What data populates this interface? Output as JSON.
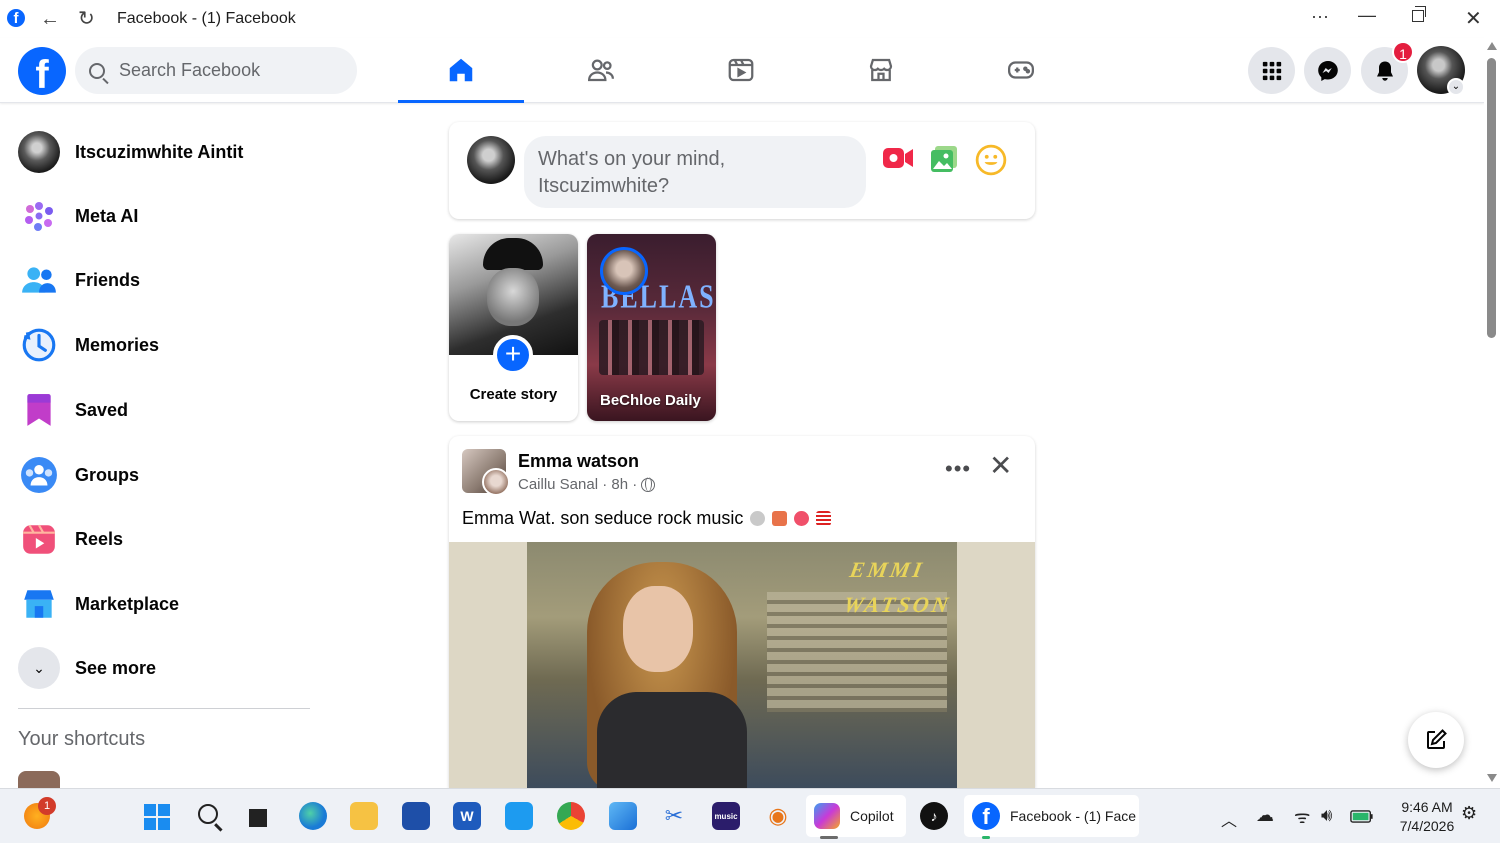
{
  "window": {
    "title": "Facebook - (1) Facebook",
    "more": "···",
    "minimize": "—",
    "close": "✕"
  },
  "header": {
    "logo": "f",
    "search_placeholder": "Search Facebook",
    "notifications_count": "1"
  },
  "sidebar": {
    "items": [
      {
        "label": "Itscuzimwhite Aintit",
        "icon": "avatar"
      },
      {
        "label": "Meta AI",
        "icon": "meta-ai-icon"
      },
      {
        "label": "Friends",
        "icon": "friends-icon"
      },
      {
        "label": "Memories",
        "icon": "memories-icon"
      },
      {
        "label": "Saved",
        "icon": "saved-icon"
      },
      {
        "label": "Groups",
        "icon": "groups-icon"
      },
      {
        "label": "Reels",
        "icon": "reels-icon"
      },
      {
        "label": "Marketplace",
        "icon": "marketplace-icon"
      },
      {
        "label": "See more",
        "icon": "chevron-down-icon"
      }
    ],
    "shortcuts_heading": "Your shortcuts"
  },
  "composer": {
    "prompt": "What's on your mind, Itscuzimwhite?"
  },
  "stories": [
    {
      "label": "Create story"
    },
    {
      "label": "BeChloe Daily",
      "poster_text": "BELLAST"
    }
  ],
  "post": {
    "author": "Emma watson",
    "meta": "Caillu Sanal · 8h ·",
    "text": "Emma Wat. son seduce rock music",
    "watermark_line1": "EMMI",
    "watermark_line2": "WATSON"
  },
  "taskbar": {
    "weather_badge": "1",
    "copilot_label": "Copilot",
    "facebook_label": "Facebook - (1) Face",
    "time": "9:46 AM",
    "date": "7/4/2026"
  },
  "colors": {
    "fb_blue": "#0866ff",
    "badge_red": "#e41e3f"
  }
}
